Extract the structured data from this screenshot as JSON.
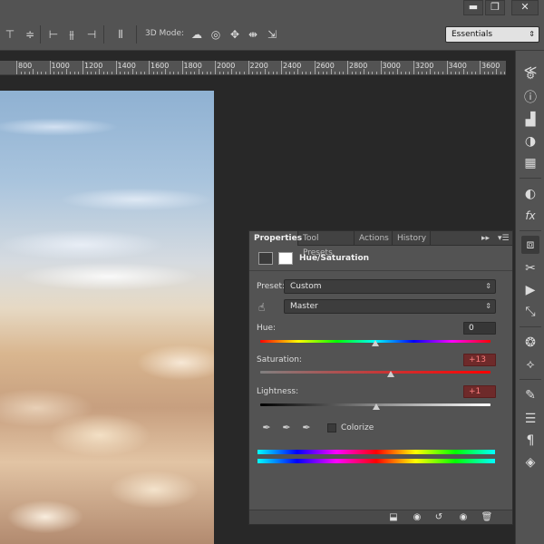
{
  "window_controls": {
    "minimize": "▬",
    "restore": "❐",
    "close": "✕"
  },
  "optbar": {
    "mode_label": "3D Mode:",
    "workspace": {
      "value": "Essentials"
    }
  },
  "ruler": {
    "ticks": [
      "800",
      "1000",
      "1200",
      "1400",
      "1600",
      "1800",
      "2000",
      "2200",
      "2400",
      "2600",
      "2800",
      "3000",
      "3200",
      "3400",
      "3600"
    ]
  },
  "panel": {
    "tabs": [
      {
        "label": "Properties",
        "active": true
      },
      {
        "label": "Tool Presets",
        "active": false
      },
      {
        "label": "Actions",
        "active": false
      },
      {
        "label": "History",
        "active": false
      }
    ],
    "title": "Hue/Saturation",
    "preset_label": "Preset:",
    "preset_value": "Custom",
    "channel_value": "Master",
    "hue_label": "Hue:",
    "hue_value": "0",
    "saturation_label": "Saturation:",
    "saturation_value": "+13",
    "lightness_label": "Lightness:",
    "lightness_value": "+1",
    "colorize_label": "Colorize",
    "colorize_checked": false
  },
  "icons": {
    "right_strip": [
      "gear-icon",
      "info-icon",
      "histogram-icon",
      "palette-icon",
      "grid-icon",
      "adjust-icon",
      "fx-icon",
      "3d-icon",
      "tools-icon",
      "play-icon",
      "transform-icon",
      "channels-icon",
      "path-icon",
      "brush-icon",
      "sliders-icon",
      "paragraph-icon",
      "layers-icon"
    ]
  },
  "colors": {
    "accent_changed": "#6e2a2a",
    "panel_bg": "#535353",
    "app_bg": "#282828"
  }
}
